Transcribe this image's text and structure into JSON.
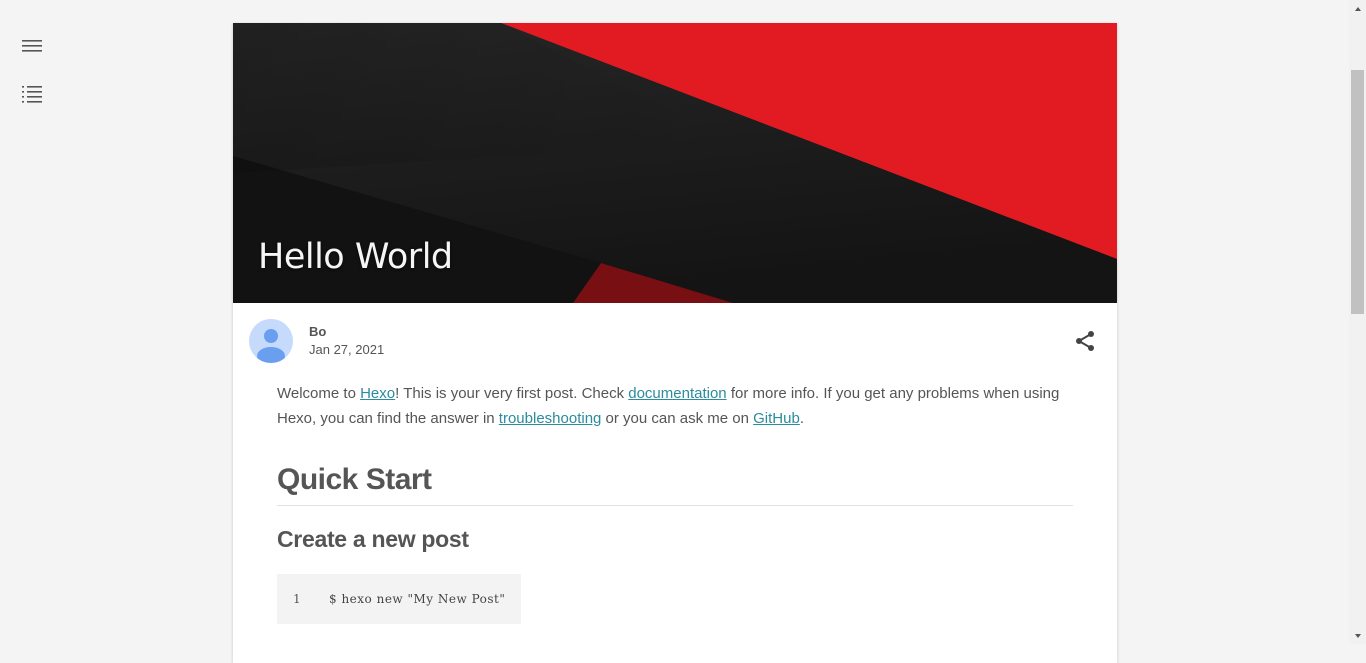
{
  "sidebar": {
    "menu_icon": "hamburger-menu-icon",
    "toc_icon": "table-of-contents-icon"
  },
  "post": {
    "title": "Hello World",
    "author": "Bo",
    "date": "Jan 27, 2021",
    "intro": {
      "t1": "Welcome to ",
      "link_hexo": "Hexo",
      "t2": "! This is your very first post. Check ",
      "link_docs": "documentation",
      "t3": " for more info. If you get any problems when using Hexo, you can find the answer in ",
      "link_troubleshooting": "troubleshooting",
      "t4": " or you can ask me on ",
      "link_github": "GitHub",
      "t5": "."
    },
    "h1": "Quick Start",
    "h2": "Create a new post",
    "code": {
      "line_number": "1",
      "line": "$ hexo new \"My New Post\""
    }
  },
  "colors": {
    "accent_red": "#e21b23",
    "hero_dark": "#1c1c1c",
    "link": "#2a8c9c",
    "avatar_bg": "#c6dafc",
    "avatar_fg": "#6a9ff0"
  }
}
